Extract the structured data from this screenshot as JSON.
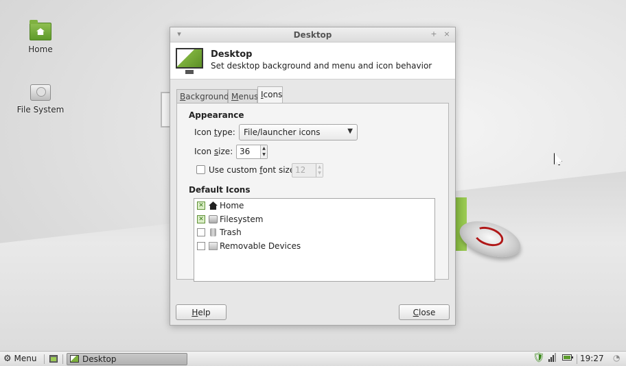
{
  "desktop": {
    "icons": [
      {
        "label": "Home",
        "icon": "home-folder-icon"
      },
      {
        "label": "File System",
        "icon": "drive-icon"
      }
    ]
  },
  "dialog": {
    "title": "Desktop",
    "header_title": "Desktop",
    "header_subtitle": "Set desktop background and menu and icon behavior",
    "tabs": [
      {
        "pre": "",
        "u": "B",
        "post": "ackground",
        "active": false
      },
      {
        "pre": "",
        "u": "M",
        "post": "enus",
        "active": false
      },
      {
        "pre": "",
        "u": "I",
        "post": "cons",
        "active": true
      }
    ],
    "appearance": {
      "heading": "Appearance",
      "icon_type_label_pre": "Icon ",
      "icon_type_label_u": "t",
      "icon_type_label_post": "ype:",
      "icon_type_value": "File/launcher icons",
      "icon_size_label_pre": "Icon ",
      "icon_size_label_u": "s",
      "icon_size_label_post": "ize:",
      "icon_size_value": "36",
      "custom_font_label_pre": "Use custom ",
      "custom_font_label_u": "f",
      "custom_font_label_post": "ont size:",
      "custom_font_checked": false,
      "custom_font_value": "12"
    },
    "default_icons": {
      "heading": "Default Icons",
      "items": [
        {
          "label": "Home",
          "checked": true,
          "icon": "home-icon"
        },
        {
          "label": "Filesystem",
          "checked": true,
          "icon": "filesystem-icon"
        },
        {
          "label": "Trash",
          "checked": false,
          "icon": "trash-icon"
        },
        {
          "label": "Removable Devices",
          "checked": false,
          "icon": "removable-devices-icon"
        }
      ]
    },
    "help_u": "H",
    "help_post": "elp",
    "close_u": "C",
    "close_post": "lose"
  },
  "taskbar": {
    "menu_label": "Menu",
    "window_label": "Desktop",
    "clock": "19:27"
  },
  "colors": {
    "accent_green": "#7fb33a",
    "check_on": "#dbeec7"
  }
}
